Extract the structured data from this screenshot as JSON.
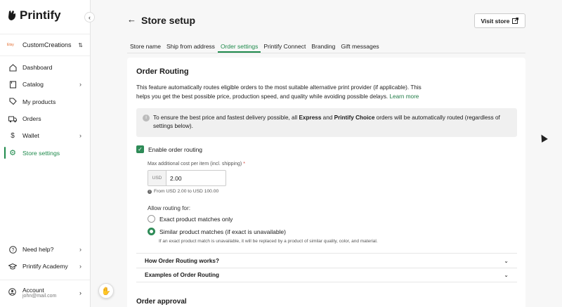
{
  "brand": {
    "name": "Printify",
    "accent": "#1f8a4c"
  },
  "store": {
    "platform": "Etsy",
    "name": "CustomCreations"
  },
  "sidebar": {
    "items": [
      {
        "label": "Dashboard",
        "icon": "home-icon"
      },
      {
        "label": "Catalog",
        "icon": "book-icon"
      },
      {
        "label": "My products",
        "icon": "tag-icon"
      },
      {
        "label": "Orders",
        "icon": "truck-icon"
      },
      {
        "label": "Wallet",
        "icon": "dollar-icon"
      },
      {
        "label": "Store settings",
        "icon": "gear-icon",
        "active": true
      }
    ],
    "bottom": [
      {
        "label": "Need help?",
        "icon": "help-icon"
      },
      {
        "label": "Printify Academy",
        "icon": "graduation-cap-icon"
      }
    ],
    "account": {
      "label": "Account",
      "email": "john@mail.com"
    }
  },
  "header": {
    "title": "Store setup",
    "visit_button": "Visit store"
  },
  "tabs": [
    {
      "label": "Store name"
    },
    {
      "label": "Ship from address"
    },
    {
      "label": "Order settings",
      "active": true
    },
    {
      "label": "Printify Connect"
    },
    {
      "label": "Branding"
    },
    {
      "label": "Gift messages"
    }
  ],
  "routing": {
    "title": "Order Routing",
    "intro": "This feature automatically routes eligible orders to the most suitable alternative print provider (if applicable). This helps you get the best possible price, production speed, and quality while avoiding possible delays.",
    "learn_more": "Learn more",
    "info_pre": "To ensure the best price and fastest delivery possible, all ",
    "info_bold1": "Express",
    "info_mid": " and ",
    "info_bold2": "Printify Choice",
    "info_post": " orders will be automatically routed (regardless of settings below).",
    "enable_label": "Enable order routing",
    "max_cost_label": "Max additional cost per item (incl. shipping)",
    "required_mark": "*",
    "currency": "USD",
    "max_cost_value": "2.00",
    "range_hint": "From USD 2.00 to USD 100.00",
    "allow_label": "Allow routing for:",
    "option_exact": "Exact product matches only",
    "option_similar": "Similar product matches (if exact is unavailable)",
    "option_similar_desc": "If an exact product match is unavailable, it will be replaced by a product of similar quality, color, and material.",
    "accordion1": "How Order Routing works?",
    "accordion2": "Examples of Order Routing"
  },
  "approval": {
    "title": "Order approval"
  }
}
